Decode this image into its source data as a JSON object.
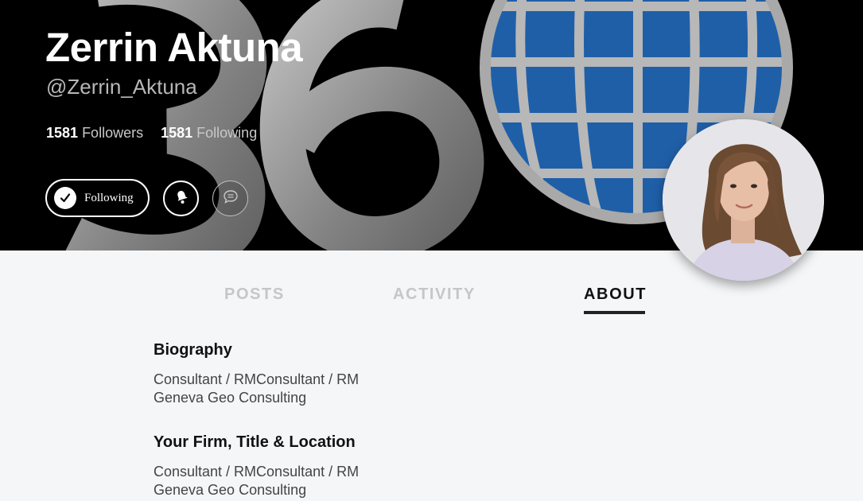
{
  "profile": {
    "name": "Zerrin Aktuna",
    "handle": "@Zerrin_Aktuna",
    "followers_count": "1581",
    "followers_label": "Followers",
    "following_count": "1581",
    "following_label": "Following"
  },
  "actions": {
    "follow_button_label": "Following",
    "icons": [
      "check-icon",
      "bell-icon",
      "chat-icon"
    ]
  },
  "tabs": [
    {
      "label": "POSTS",
      "active": false
    },
    {
      "label": "ACTIVITY",
      "active": false
    },
    {
      "label": "ABOUT",
      "active": true
    }
  ],
  "about": {
    "sections": [
      {
        "title": "Biography",
        "lines": [
          "Consultant / RMConsultant / RM",
          "Geneva Geo Consulting"
        ]
      },
      {
        "title": "Your Firm, Title & Location",
        "lines": [
          "Consultant / RMConsultant / RM",
          "Geneva Geo Consulting"
        ]
      }
    ]
  },
  "colors": {
    "banner_background": "#000000",
    "page_background": "#f5f6f8",
    "globe_blue": "#1f5fa8",
    "logo_gray": "#9a9a9a",
    "active_tab": "#111111",
    "inactive_tab": "#c4c6c9"
  }
}
